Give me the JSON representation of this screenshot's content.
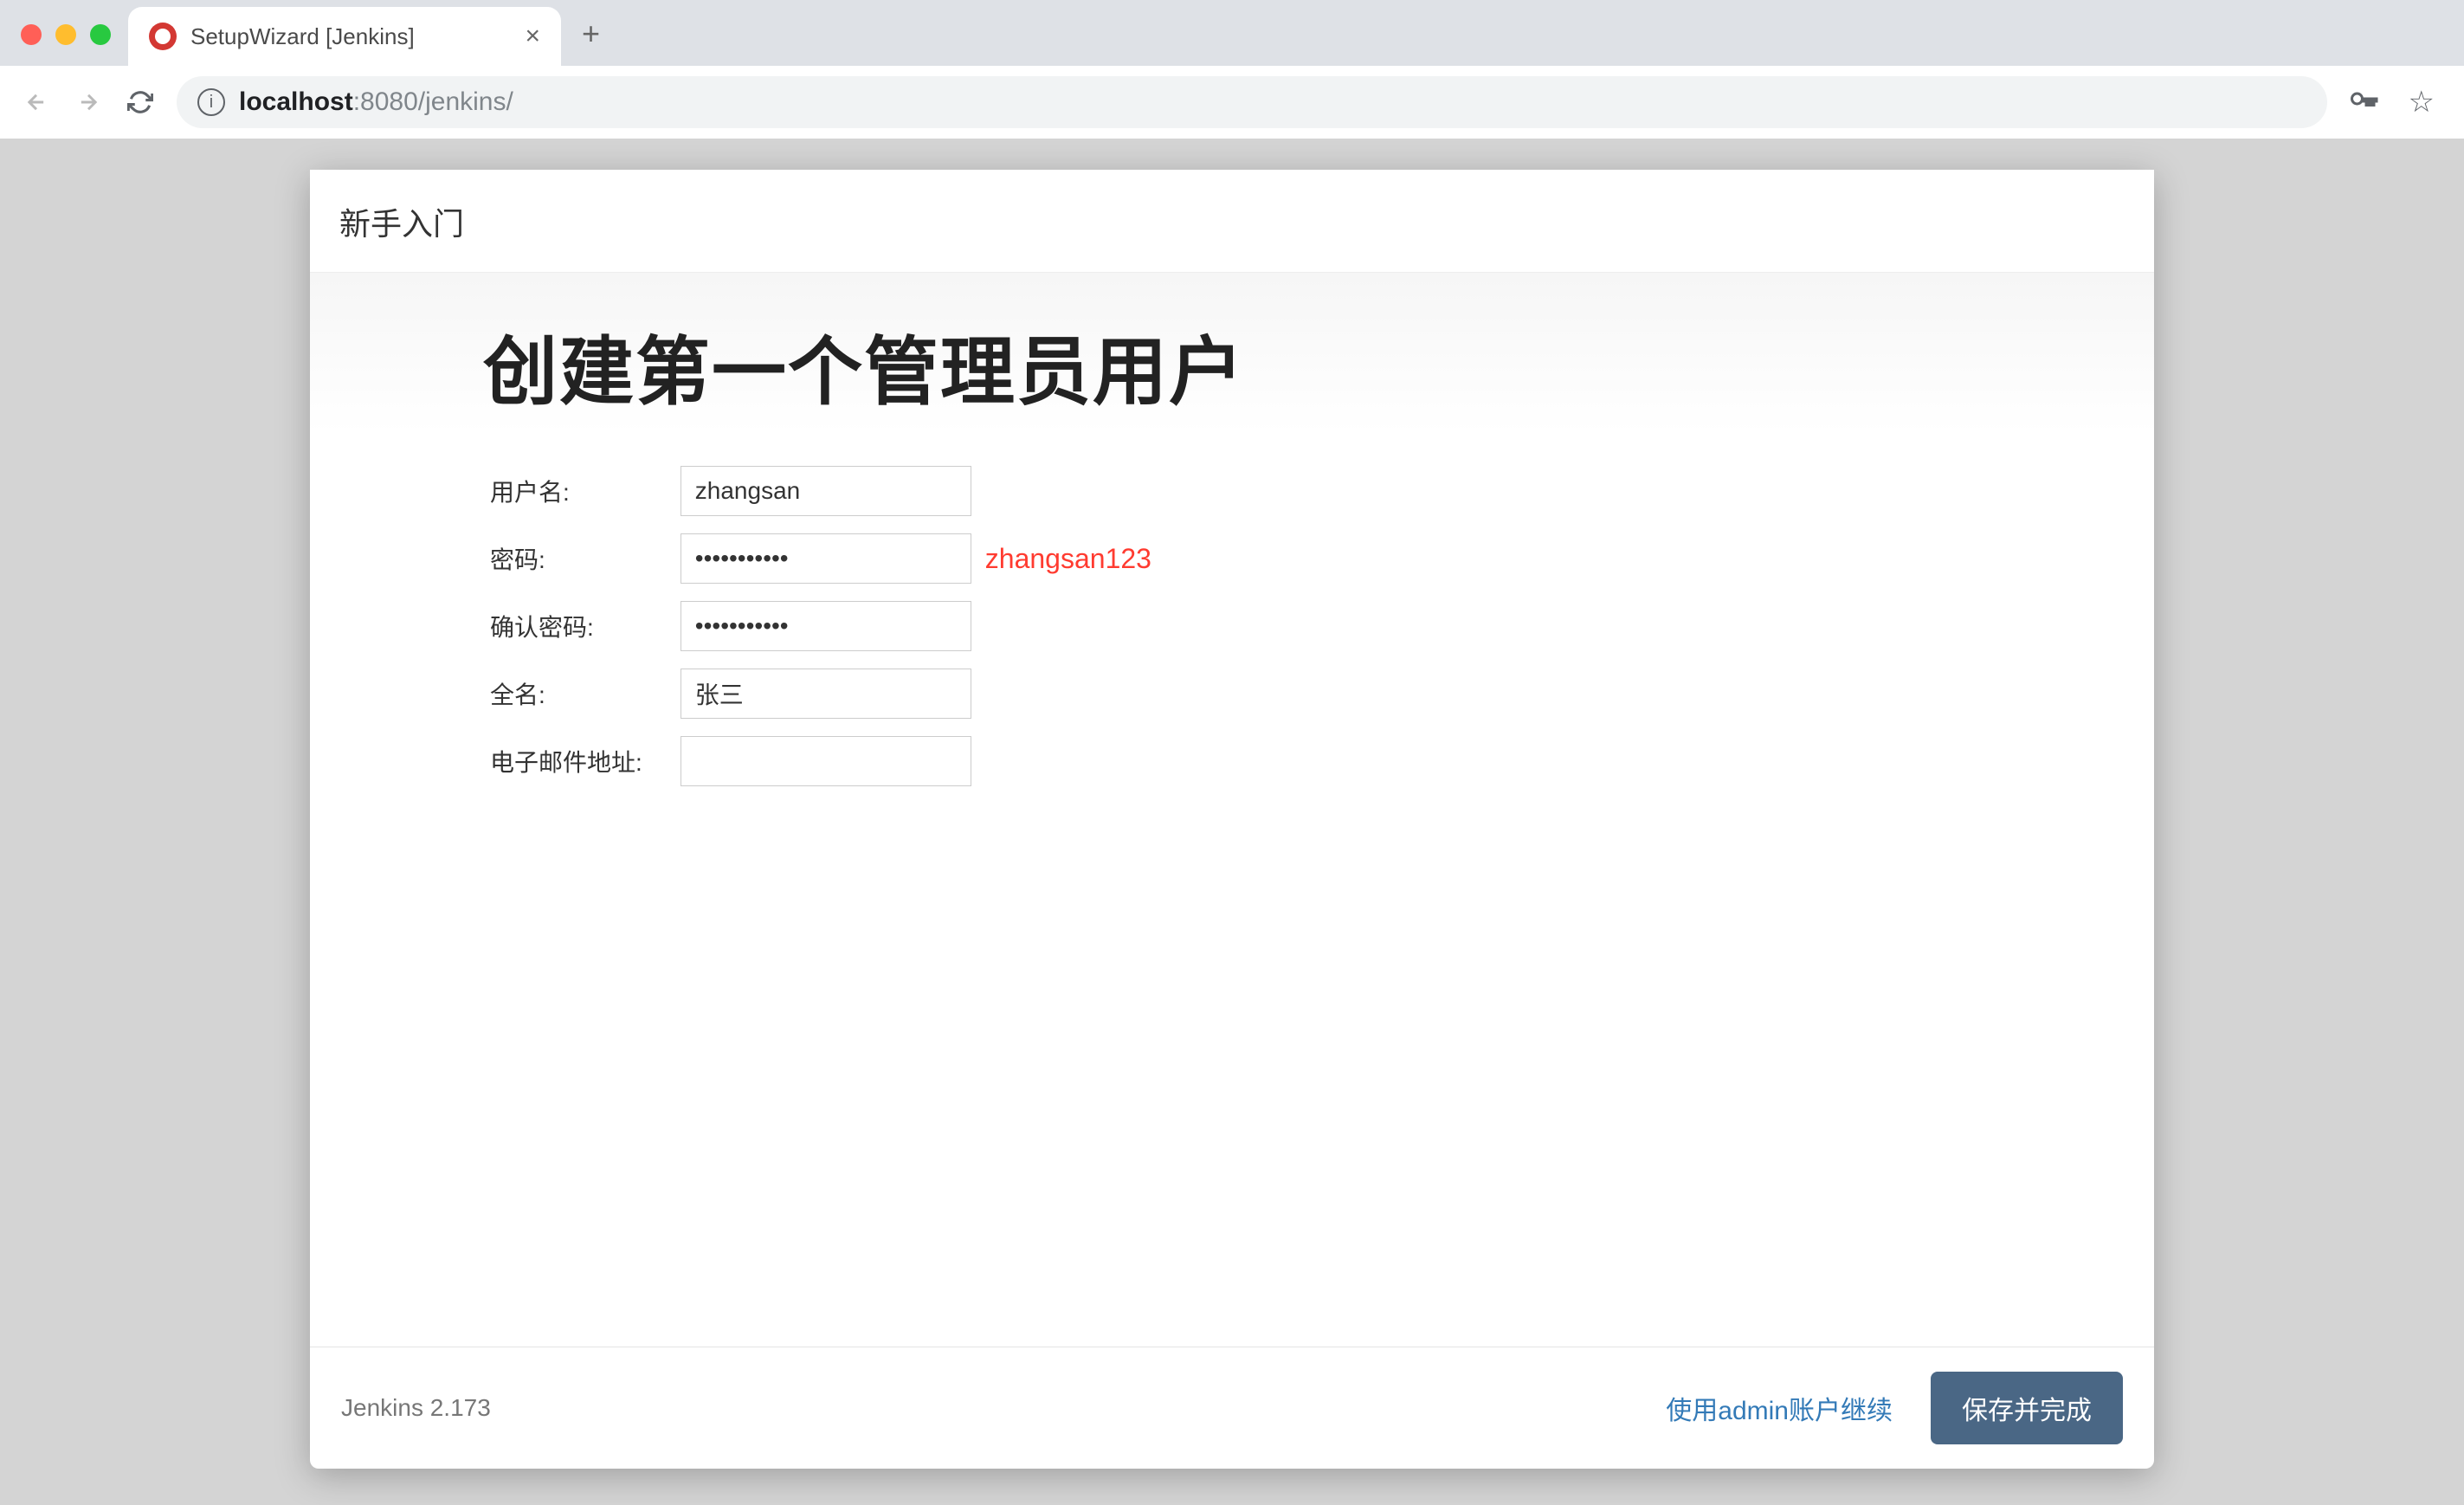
{
  "browser": {
    "tab_title": "SetupWizard [Jenkins]",
    "url_host_bold": "localhost",
    "url_host_rest": ":8080/jenkins/"
  },
  "modal": {
    "header": "新手入门"
  },
  "page": {
    "title": "创建第一个管理员用户"
  },
  "form": {
    "username": {
      "label": "用户名:",
      "value": "zhangsan"
    },
    "password": {
      "label": "密码:",
      "value": "•••••••••••",
      "annotation": "zhangsan123"
    },
    "confirm_password": {
      "label": "确认密码:",
      "value": "•••••••••••"
    },
    "fullname": {
      "label": "全名:",
      "value": "张三"
    },
    "email": {
      "label": "电子邮件地址:",
      "value": ""
    }
  },
  "footer": {
    "version": "Jenkins 2.173",
    "continue_as_admin": "使用admin账户继续",
    "save_and_finish": "保存并完成"
  }
}
